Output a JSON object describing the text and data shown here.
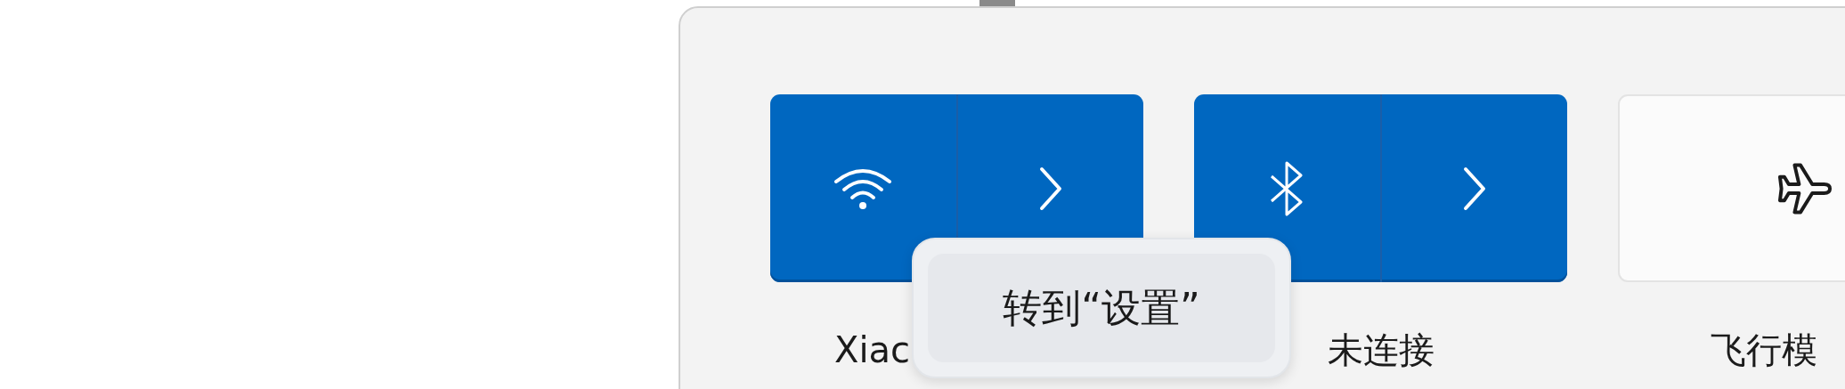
{
  "tiles": [
    {
      "kind": "wifi",
      "on": true,
      "expandable": true,
      "label": "Xiac"
    },
    {
      "kind": "bluetooth",
      "on": true,
      "expandable": true,
      "label": "未连接"
    },
    {
      "kind": "airplane",
      "on": false,
      "expandable": false,
      "label": "飞行模"
    }
  ],
  "tooltip": {
    "text": "转到“设置”"
  }
}
